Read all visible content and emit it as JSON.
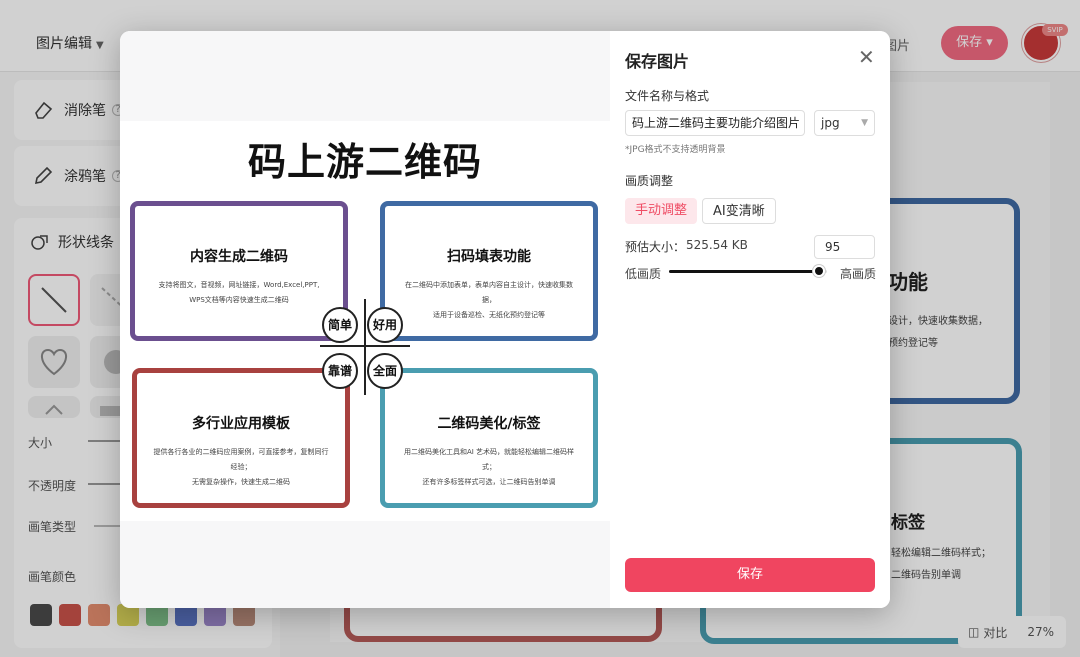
{
  "header": {
    "menu_label": "图片编辑",
    "image_button": "图片",
    "save_label": "保存",
    "svip_badge": "SVIP"
  },
  "tools": {
    "eraser": "消除笔",
    "brush": "涂鸦笔",
    "shape": "形状线条",
    "help_glyph": "?"
  },
  "props": {
    "size": "大小",
    "opacity": "不透明度",
    "brush_type": "画笔类型",
    "brush_color": "画笔颜色"
  },
  "swatches": [
    "#4a4a4a",
    "#c8524a",
    "#e38d6e",
    "#d9d35a",
    "#7fc18a",
    "#5a73c2",
    "#9a86c8",
    "#b98b7a"
  ],
  "background": {
    "partial_1": "功能",
    "partial_1_line1": "设计，快速收集数据，",
    "partial_1_line2": "预约登记等",
    "partial_2": "标签",
    "partial_2_line1": "轻松编辑二维码样式；",
    "partial_2_line2": "二维码告别单调"
  },
  "bottom": {
    "compare": "对比",
    "zoom": "27%"
  },
  "dialog": {
    "title": "保存图片",
    "file_label": "文件名称与格式",
    "file_name": "码上游二维码主要功能介绍图片",
    "format": "jpg",
    "format_note": "*JPG格式不支持透明背景",
    "quality_label": "画质调整",
    "tab_manual": "手动调整",
    "tab_ai": "AI变清晰",
    "size_label": "预估大小：",
    "size_value": "525.54 KB",
    "quality_value": "95",
    "quality_fraction": 0.95,
    "low_label": "低画质",
    "high_label": "高画质",
    "save_button": "保存"
  },
  "poster": {
    "title": "码上游二维码",
    "cards": [
      {
        "heading": "内容生成二维码",
        "line1": "支持将图文，音视频，网址链接，Word,Excel,PPT,",
        "line2": "WPS文档等内容快速生成二维码",
        "color": "#6b4f8f"
      },
      {
        "heading": "扫码填表功能",
        "line1": "在二维码中添加表单，表单内容自主设计，快速收集数据，",
        "line2": "适用于设备巡检、无纸化预约登记等",
        "color": "#3f6aa3"
      },
      {
        "heading": "多行业应用模板",
        "line1": "提供各行各业的二维码应用案例，可直接参考，复制同行经验；",
        "line2": "无需复杂操作，快速生成二维码",
        "color": "#a8413f"
      },
      {
        "heading": "二维码美化/标签",
        "line1": "用二维码美化工具和AI 艺术码，就能轻松编辑二维码样式；",
        "line2": "还有许多标签样式可选，让二维码告别单调",
        "color": "#4a9db0"
      }
    ],
    "bubbles": [
      "简单",
      "好用",
      "靠谱",
      "全面"
    ]
  }
}
